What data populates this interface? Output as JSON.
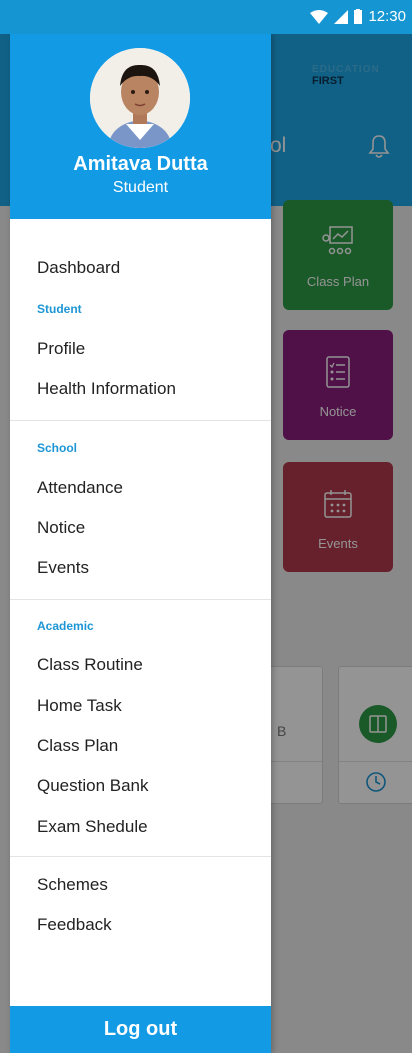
{
  "status_bar": {
    "time": "12:30"
  },
  "background_app": {
    "brand_top": "EDUCATION",
    "brand_bottom": "FIRST",
    "title_fragment": "ol",
    "tiles": [
      {
        "label": "Class Plan",
        "color": "#2e9a46"
      },
      {
        "label": "Notice",
        "color": "#8a1c7c"
      },
      {
        "label": "Events",
        "color": "#b23a4c"
      }
    ],
    "card_text": "B"
  },
  "drawer": {
    "user_name": "Amitava Dutta",
    "user_role": "Student",
    "items": {
      "dashboard": "Dashboard",
      "student_section": "Student",
      "profile": "Profile",
      "health": "Health Information",
      "school_section": "School",
      "attendance": "Attendance",
      "notice": "Notice",
      "events": "Events",
      "academic_section": "Academic",
      "class_routine": "Class Routine",
      "home_task": "Home Task",
      "class_plan": "Class Plan",
      "question_bank": "Question Bank",
      "exam_schedule": "Exam Shedule",
      "schemes": "Schemes",
      "feedback": "Feedback"
    },
    "logout": "Log out"
  }
}
